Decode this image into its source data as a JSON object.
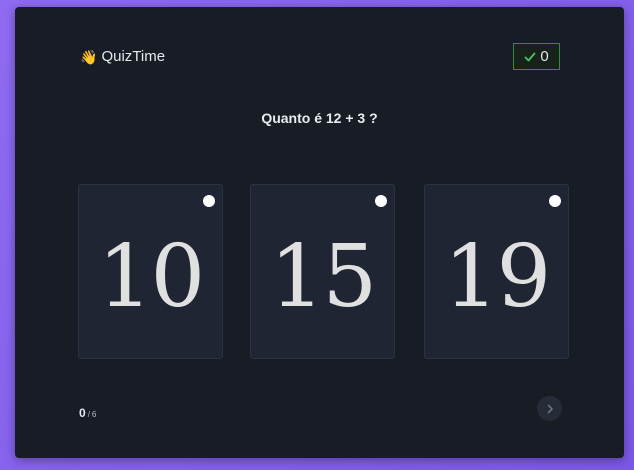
{
  "app": {
    "name": "QuizTime",
    "logo_icon": "waving-hand-icon"
  },
  "score": {
    "value": "0",
    "icon": "check-icon",
    "border_color": "#2f8f3a"
  },
  "question": {
    "text": "Quanto é 12 + 3 ?"
  },
  "options": [
    {
      "label": "10"
    },
    {
      "label": "15"
    },
    {
      "label": "19"
    }
  ],
  "progress": {
    "current": "0",
    "separator": "/",
    "total": "6"
  },
  "next": {
    "icon": "chevron-right-icon"
  },
  "colors": {
    "card": "#181c25",
    "option_bg": "#202533",
    "background": "#8f6bf2"
  }
}
